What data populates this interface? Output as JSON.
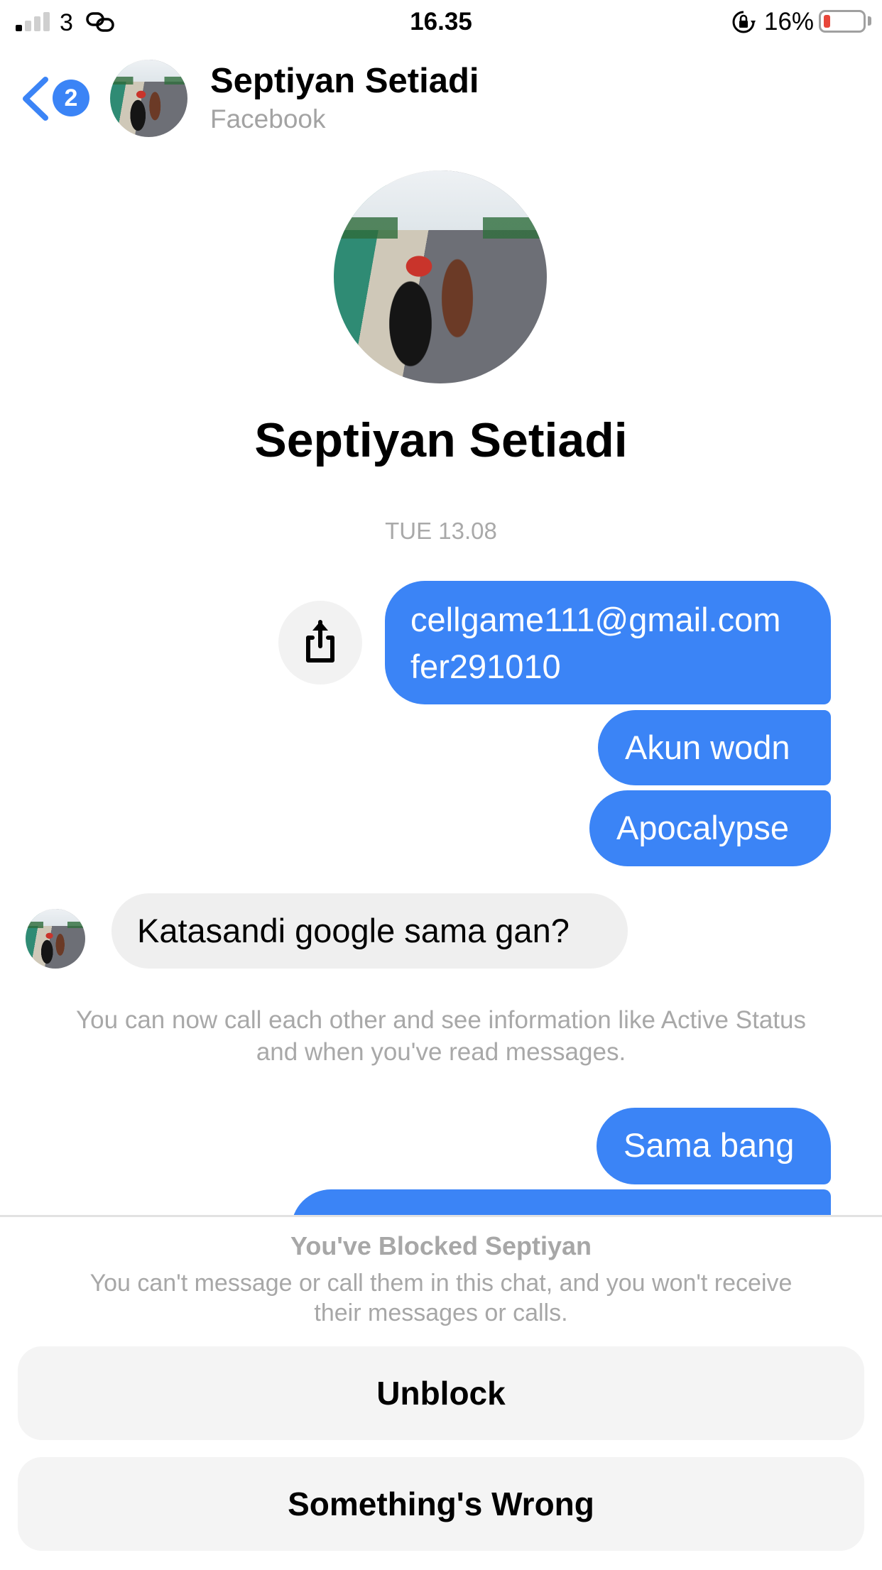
{
  "status_bar": {
    "carrier": "3",
    "time": "16.35",
    "battery_percent": "16%",
    "battery_level": 0.16,
    "signal_bars_active": 1,
    "signal_bars_total": 4,
    "icons": [
      "signal-icon",
      "link-icon",
      "rotation-lock-icon",
      "battery-icon"
    ]
  },
  "header": {
    "back_badge_count": "2",
    "contact_name": "Septiyan Setiadi",
    "subtitle": "Facebook"
  },
  "profile": {
    "name": "Septiyan Setiadi"
  },
  "conversation": {
    "date_separator": "TUE 13.08",
    "messages": [
      {
        "direction": "outgoing",
        "lines": [
          "cellgame111@gmail.com",
          "fer291010"
        ]
      },
      {
        "direction": "outgoing",
        "text": "Akun wodn"
      },
      {
        "direction": "outgoing",
        "text": "Apocalypse"
      },
      {
        "direction": "incoming",
        "text": "Katasandi google sama gan?"
      },
      {
        "direction": "system",
        "text": "You can now call each other and see information like Active Status and when you've read messages."
      },
      {
        "direction": "outgoing",
        "text": "Sama bang"
      },
      {
        "direction": "outgoing",
        "text": ""
      }
    ]
  },
  "blocked_panel": {
    "title": "You've Blocked Septiyan",
    "description": "You can't message or call them in this chat, and you won't receive their messages or calls.",
    "unblock_label": "Unblock",
    "report_label": "Something's Wrong"
  },
  "colors": {
    "accent": "#3b84f6",
    "incoming_bubble": "#efefef",
    "muted_text": "#a8a8a8",
    "button_bg": "#f4f4f4",
    "battery_low": "#e8463a"
  }
}
